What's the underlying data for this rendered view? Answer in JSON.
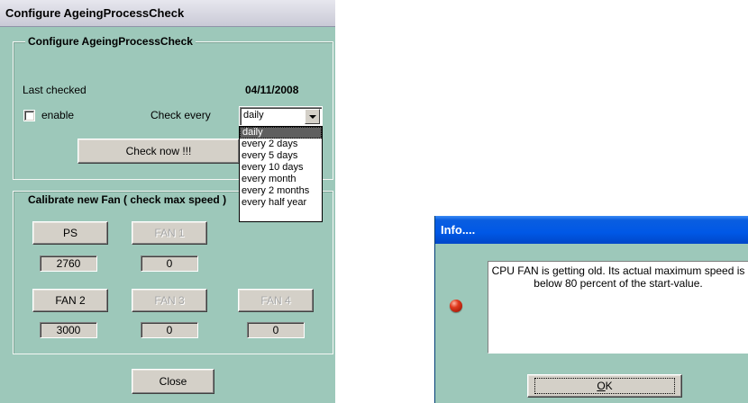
{
  "config_window": {
    "title": "Configure AgeingProcessCheck",
    "group1": {
      "legend": "Configure AgeingProcessCheck",
      "last_checked_label": "Last checked",
      "last_checked_value": "04/11/2008",
      "enable_label": "enable",
      "enable_checked": false,
      "check_every_label": "Check every",
      "check_every_value": "daily",
      "check_every_options": [
        "daily",
        "every 2 days",
        "every 5 days",
        "every 10 days",
        "every month",
        "every 2 months",
        "every half year"
      ],
      "check_now_label": "Check now !!!"
    },
    "group2": {
      "legend": "Calibrate new Fan ( check max speed )",
      "fans": [
        {
          "label": "PS",
          "value": "2760",
          "enabled": true
        },
        {
          "label": "FAN 1",
          "value": "0",
          "enabled": false
        },
        {
          "label": "FAN 2",
          "value": "3000",
          "enabled": true
        },
        {
          "label": "FAN 3",
          "value": "0",
          "enabled": false
        },
        {
          "label": "FAN 4",
          "value": "0",
          "enabled": false
        }
      ]
    },
    "close_label": "Close"
  },
  "info_window": {
    "title": "Info....",
    "message": "CPU FAN is getting old. Its actual maximum speed is below 80 percent of the start-value.",
    "ok_label": "OK",
    "ok_mnemonic": "O",
    "ok_rest": "K",
    "icon": "red-ball-icon"
  },
  "colors": {
    "dialog_bg": "#9dc8ba",
    "xp_title_blue": "#0058e6"
  }
}
